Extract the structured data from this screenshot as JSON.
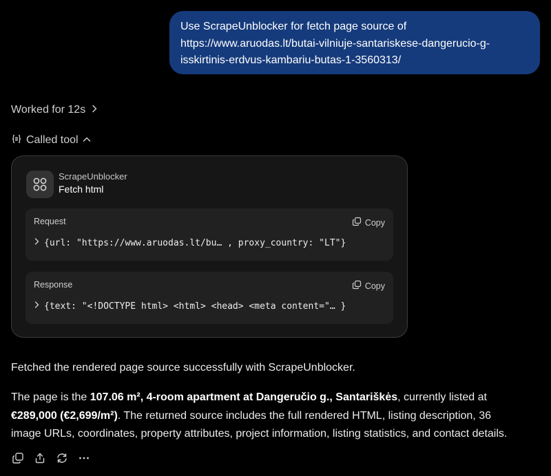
{
  "user_message": {
    "lines": [
      "Use ScrapeUnblocker for fetch page source of",
      "https://www.aruodas.lt/butai-vilniuje-santariskese-dangerucio-g-",
      "isskirtinis-erdvus-kambariu-butas-1-3560313/"
    ]
  },
  "worked": {
    "label": "Worked for 12s",
    "icon": "chevron-right-icon"
  },
  "called_tool": {
    "label": "Called tool",
    "icon": "tool-braces-icon",
    "toggle_icon": "chevron-up-icon"
  },
  "tool_card": {
    "app_name": "ScrapeUnblocker",
    "action": "Fetch html",
    "app_icon": "four-circles-icon",
    "request": {
      "label": "Request",
      "copy_label": "Copy",
      "code": "{url: \"https://www.aruodas.lt/bu… , proxy_country: \"LT\"}"
    },
    "response": {
      "label": "Response",
      "copy_label": "Copy",
      "code": "{text: \"<!DOCTYPE html> <html> <head> <meta content=\"… }"
    }
  },
  "answer": {
    "p1": "Fetched the rendered page source successfully with ScrapeUnblocker.",
    "p2": {
      "t1": "The page is the ",
      "b1": "107.06 m², 4-room apartment at Dangeručio g., Santariškės",
      "t2": ", currently listed at",
      "b2": "€289,000 (€2,699/m²)",
      "t3": ". The returned source includes the full rendered HTML, listing description, 36",
      "t4": "image URLs, coordinates, property attributes, project information, listing statistics, and contact details."
    }
  },
  "actions": [
    "copy-icon",
    "share-icon",
    "regenerate-icon",
    "more-icon"
  ]
}
